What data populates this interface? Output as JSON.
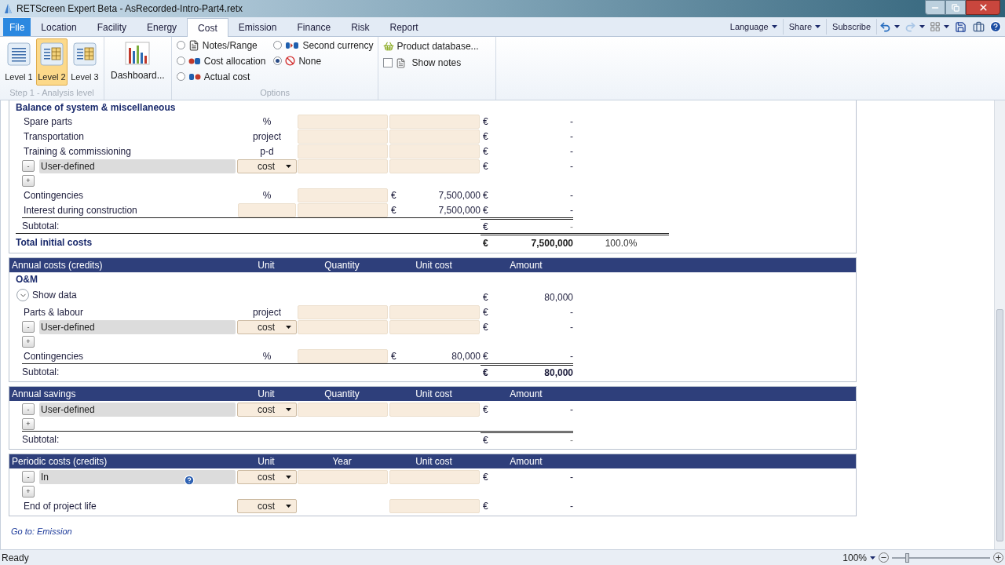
{
  "window": {
    "title": "RETScreen Expert Beta - AsRecorded-Intro-Part4.retx"
  },
  "tabs": [
    {
      "label": "File",
      "kind": "file",
      "selected": false
    },
    {
      "label": "Location",
      "kind": "tab",
      "selected": false
    },
    {
      "label": "Facility",
      "kind": "tab",
      "selected": false
    },
    {
      "label": "Energy",
      "kind": "tab",
      "selected": false
    },
    {
      "label": "Cost",
      "kind": "tab",
      "selected": true
    },
    {
      "label": "Emission",
      "kind": "tab",
      "selected": false
    },
    {
      "label": "Finance",
      "kind": "tab",
      "selected": false
    },
    {
      "label": "Risk",
      "kind": "tab",
      "selected": false
    },
    {
      "label": "Report",
      "kind": "tab",
      "selected": false
    }
  ],
  "toolbar": [
    {
      "label": "Language",
      "dropdown": true
    },
    {
      "label": "Share",
      "dropdown": true
    },
    {
      "label": "Subscribe",
      "dropdown": false
    }
  ],
  "ribbon": {
    "levels": {
      "items": [
        {
          "label": "Level 1",
          "kind": "lines",
          "selected": false
        },
        {
          "label": "Level 2",
          "kind": "grid",
          "selected": true
        },
        {
          "label": "Level 3",
          "kind": "grid",
          "selected": false
        }
      ],
      "caption": "Step 1 - Analysis level"
    },
    "dashboard": {
      "label": "Dashboard..."
    },
    "options": {
      "radios": [
        {
          "label": "Notes/Range",
          "kind": "notes",
          "selected": false
        },
        {
          "label": "Cost allocation",
          "kind": "allocation",
          "selected": false
        },
        {
          "label": "Actual cost",
          "kind": "actual",
          "selected": false
        },
        {
          "label": "Second currency",
          "kind": "currency",
          "selected": false
        },
        {
          "label": "None",
          "kind": "none",
          "selected": true
        }
      ],
      "caption": "Options"
    },
    "product_database": {
      "label": "Product database..."
    },
    "show_notes": {
      "label": "Show notes",
      "checked": false
    }
  },
  "sections": [
    {
      "rows": [
        {
          "kind": "group",
          "label": "Balance of system & miscellaneous"
        },
        {
          "kind": "item",
          "label": "Spare parts",
          "unit": "%",
          "quantity_field": true,
          "cost_field": true,
          "currency": "€",
          "amount": "-"
        },
        {
          "kind": "item",
          "label": "Transportation",
          "unit": "project",
          "quantity_field": true,
          "cost_field": true,
          "currency": "€",
          "amount": "-"
        },
        {
          "kind": "item",
          "label": "Training & commissioning",
          "unit": "p-d",
          "quantity_field": true,
          "cost_field": true,
          "currency": "€",
          "amount": "-"
        },
        {
          "kind": "user",
          "remove": "-",
          "value": "User-defined",
          "unit_select": "cost",
          "quantity_field": true,
          "cost_field": true,
          "currency": "€",
          "amount": "-"
        },
        {
          "kind": "add",
          "label": "+"
        },
        {
          "kind": "item",
          "label": "Contingencies",
          "unit": "%",
          "quantity_field": true,
          "cost_field": false,
          "cost_currency": "€",
          "cost": "7,500,000",
          "currency": "€",
          "amount": "-"
        },
        {
          "kind": "item",
          "label": "Interest during construction",
          "unit_field": true,
          "quantity_field": true,
          "cost_field": false,
          "cost_currency": "€",
          "cost": "7,500,000",
          "currency": "€",
          "amount": "-"
        },
        {
          "kind": "subtotal",
          "label": "Subtotal:",
          "currency": "€",
          "amount": "-",
          "bold": false
        },
        {
          "kind": "total",
          "label": "Total initial costs",
          "currency": "€",
          "amount": "7,500,000",
          "percent": "100.0%"
        }
      ]
    },
    {
      "header": {
        "title": "Annual costs (credits)",
        "columns": [
          "Unit",
          "Quantity",
          "Unit cost",
          "Amount"
        ]
      },
      "rows": [
        {
          "kind": "group",
          "label": "O&M"
        },
        {
          "kind": "toggle",
          "label": "Show data",
          "currency": "€",
          "amount": "80,000"
        },
        {
          "kind": "item",
          "label": "Parts & labour",
          "unit": "project",
          "quantity_field": true,
          "cost_field": true,
          "currency": "€",
          "amount": "-"
        },
        {
          "kind": "user",
          "remove": "-",
          "value": "User-defined",
          "unit_select": "cost",
          "quantity_field": true,
          "cost_field": true,
          "currency": "€",
          "amount": "-"
        },
        {
          "kind": "add",
          "label": "+"
        },
        {
          "kind": "item",
          "label": "Contingencies",
          "unit": "%",
          "quantity_field": true,
          "cost_field": false,
          "cost_currency": "€",
          "cost": "80,000",
          "currency": "€",
          "amount": "-"
        },
        {
          "kind": "subtotal",
          "label": "Subtotal:",
          "currency": "€",
          "amount": "80,000",
          "bold": true
        }
      ]
    },
    {
      "header": {
        "title": "Annual savings",
        "columns": [
          "Unit",
          "Quantity",
          "Unit cost",
          "Amount"
        ]
      },
      "rows": [
        {
          "kind": "user",
          "remove": "-",
          "value": "User-defined",
          "unit_select": "cost",
          "quantity_field": true,
          "cost_field": true,
          "currency": "€",
          "amount": "-"
        },
        {
          "kind": "add",
          "label": "+"
        },
        {
          "kind": "subtotal",
          "label": "Subtotal:",
          "currency": "€",
          "amount": "-",
          "bold": false
        }
      ]
    },
    {
      "header": {
        "title": "Periodic costs (credits)",
        "columns": [
          "Unit",
          "Year",
          "Unit cost",
          "Amount"
        ]
      },
      "rows": [
        {
          "kind": "user",
          "remove": "-",
          "value": "In",
          "help": true,
          "unit_select": "cost",
          "quantity_field": true,
          "cost_field": true,
          "currency": "€",
          "amount": "-"
        },
        {
          "kind": "add",
          "label": "+"
        },
        {
          "kind": "item",
          "label": "End of project life",
          "unit_select": "cost",
          "quantity_field": false,
          "cost_field": true,
          "currency": "€",
          "amount": "-"
        }
      ]
    }
  ],
  "link": "Go to: Emission",
  "status_bar": {
    "text": "Ready",
    "zoom": "100%",
    "zoom_slider": {
      "level": 0.15
    }
  }
}
